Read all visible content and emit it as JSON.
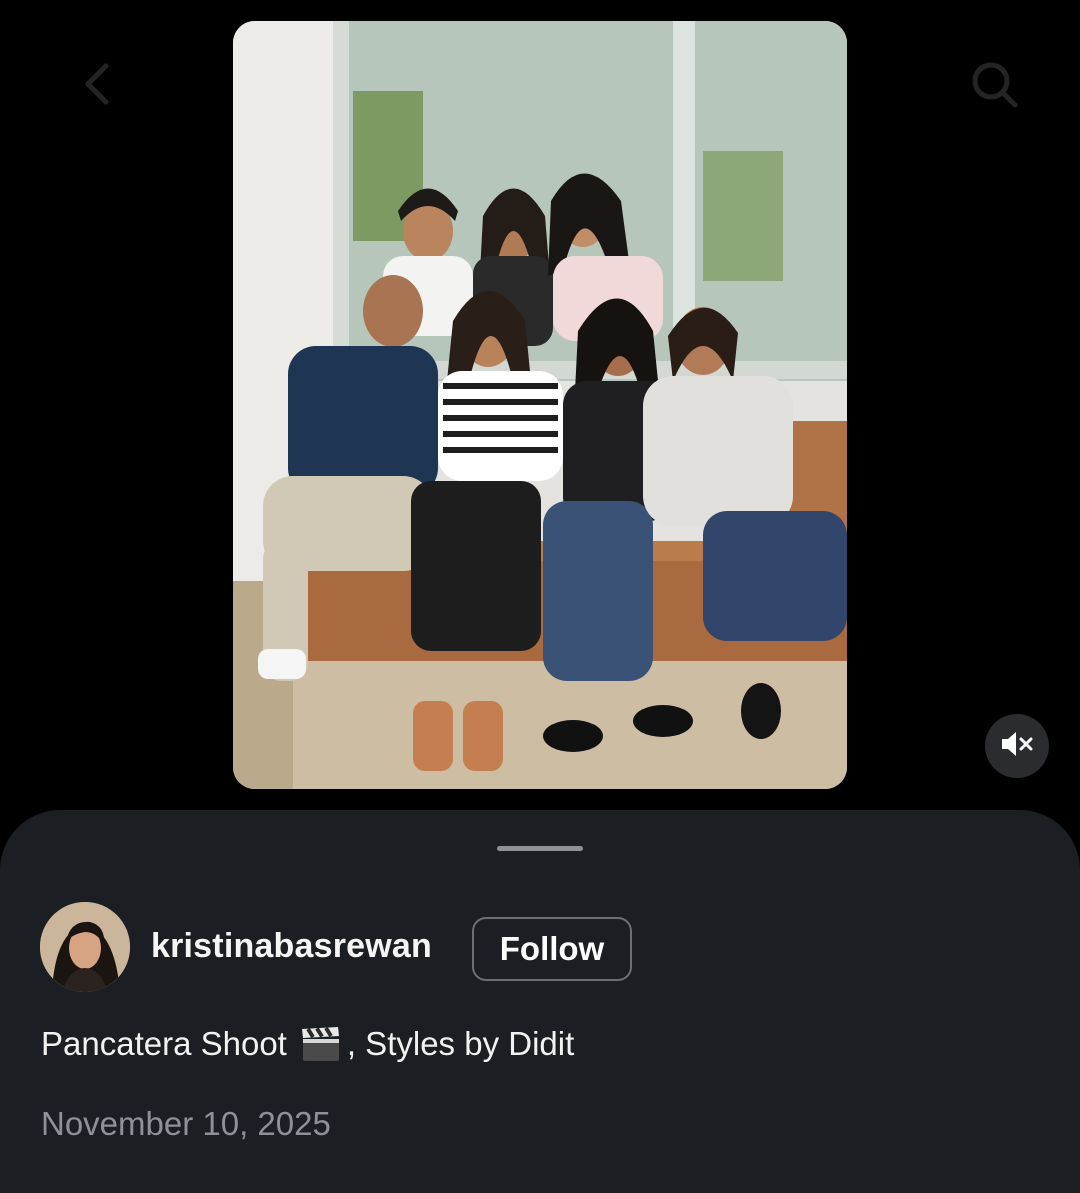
{
  "top_bar": {
    "back_icon": "chevron-left-icon",
    "search_icon": "search-icon"
  },
  "media": {
    "type": "photo",
    "mute_icon": "speaker-muted-icon"
  },
  "post": {
    "username": "kristinabasrewan",
    "follow_label": "Follow",
    "caption_before": "Pancatera Shoot",
    "caption_emoji": "clapper-board-icon",
    "caption_after": ", Styles by Didit",
    "date": "November 10, 2025"
  },
  "colors": {
    "sheet_background": "#1b1f23",
    "page_background": "#000000",
    "date_text": "#8e9298",
    "follow_border": "#6c6f73"
  }
}
